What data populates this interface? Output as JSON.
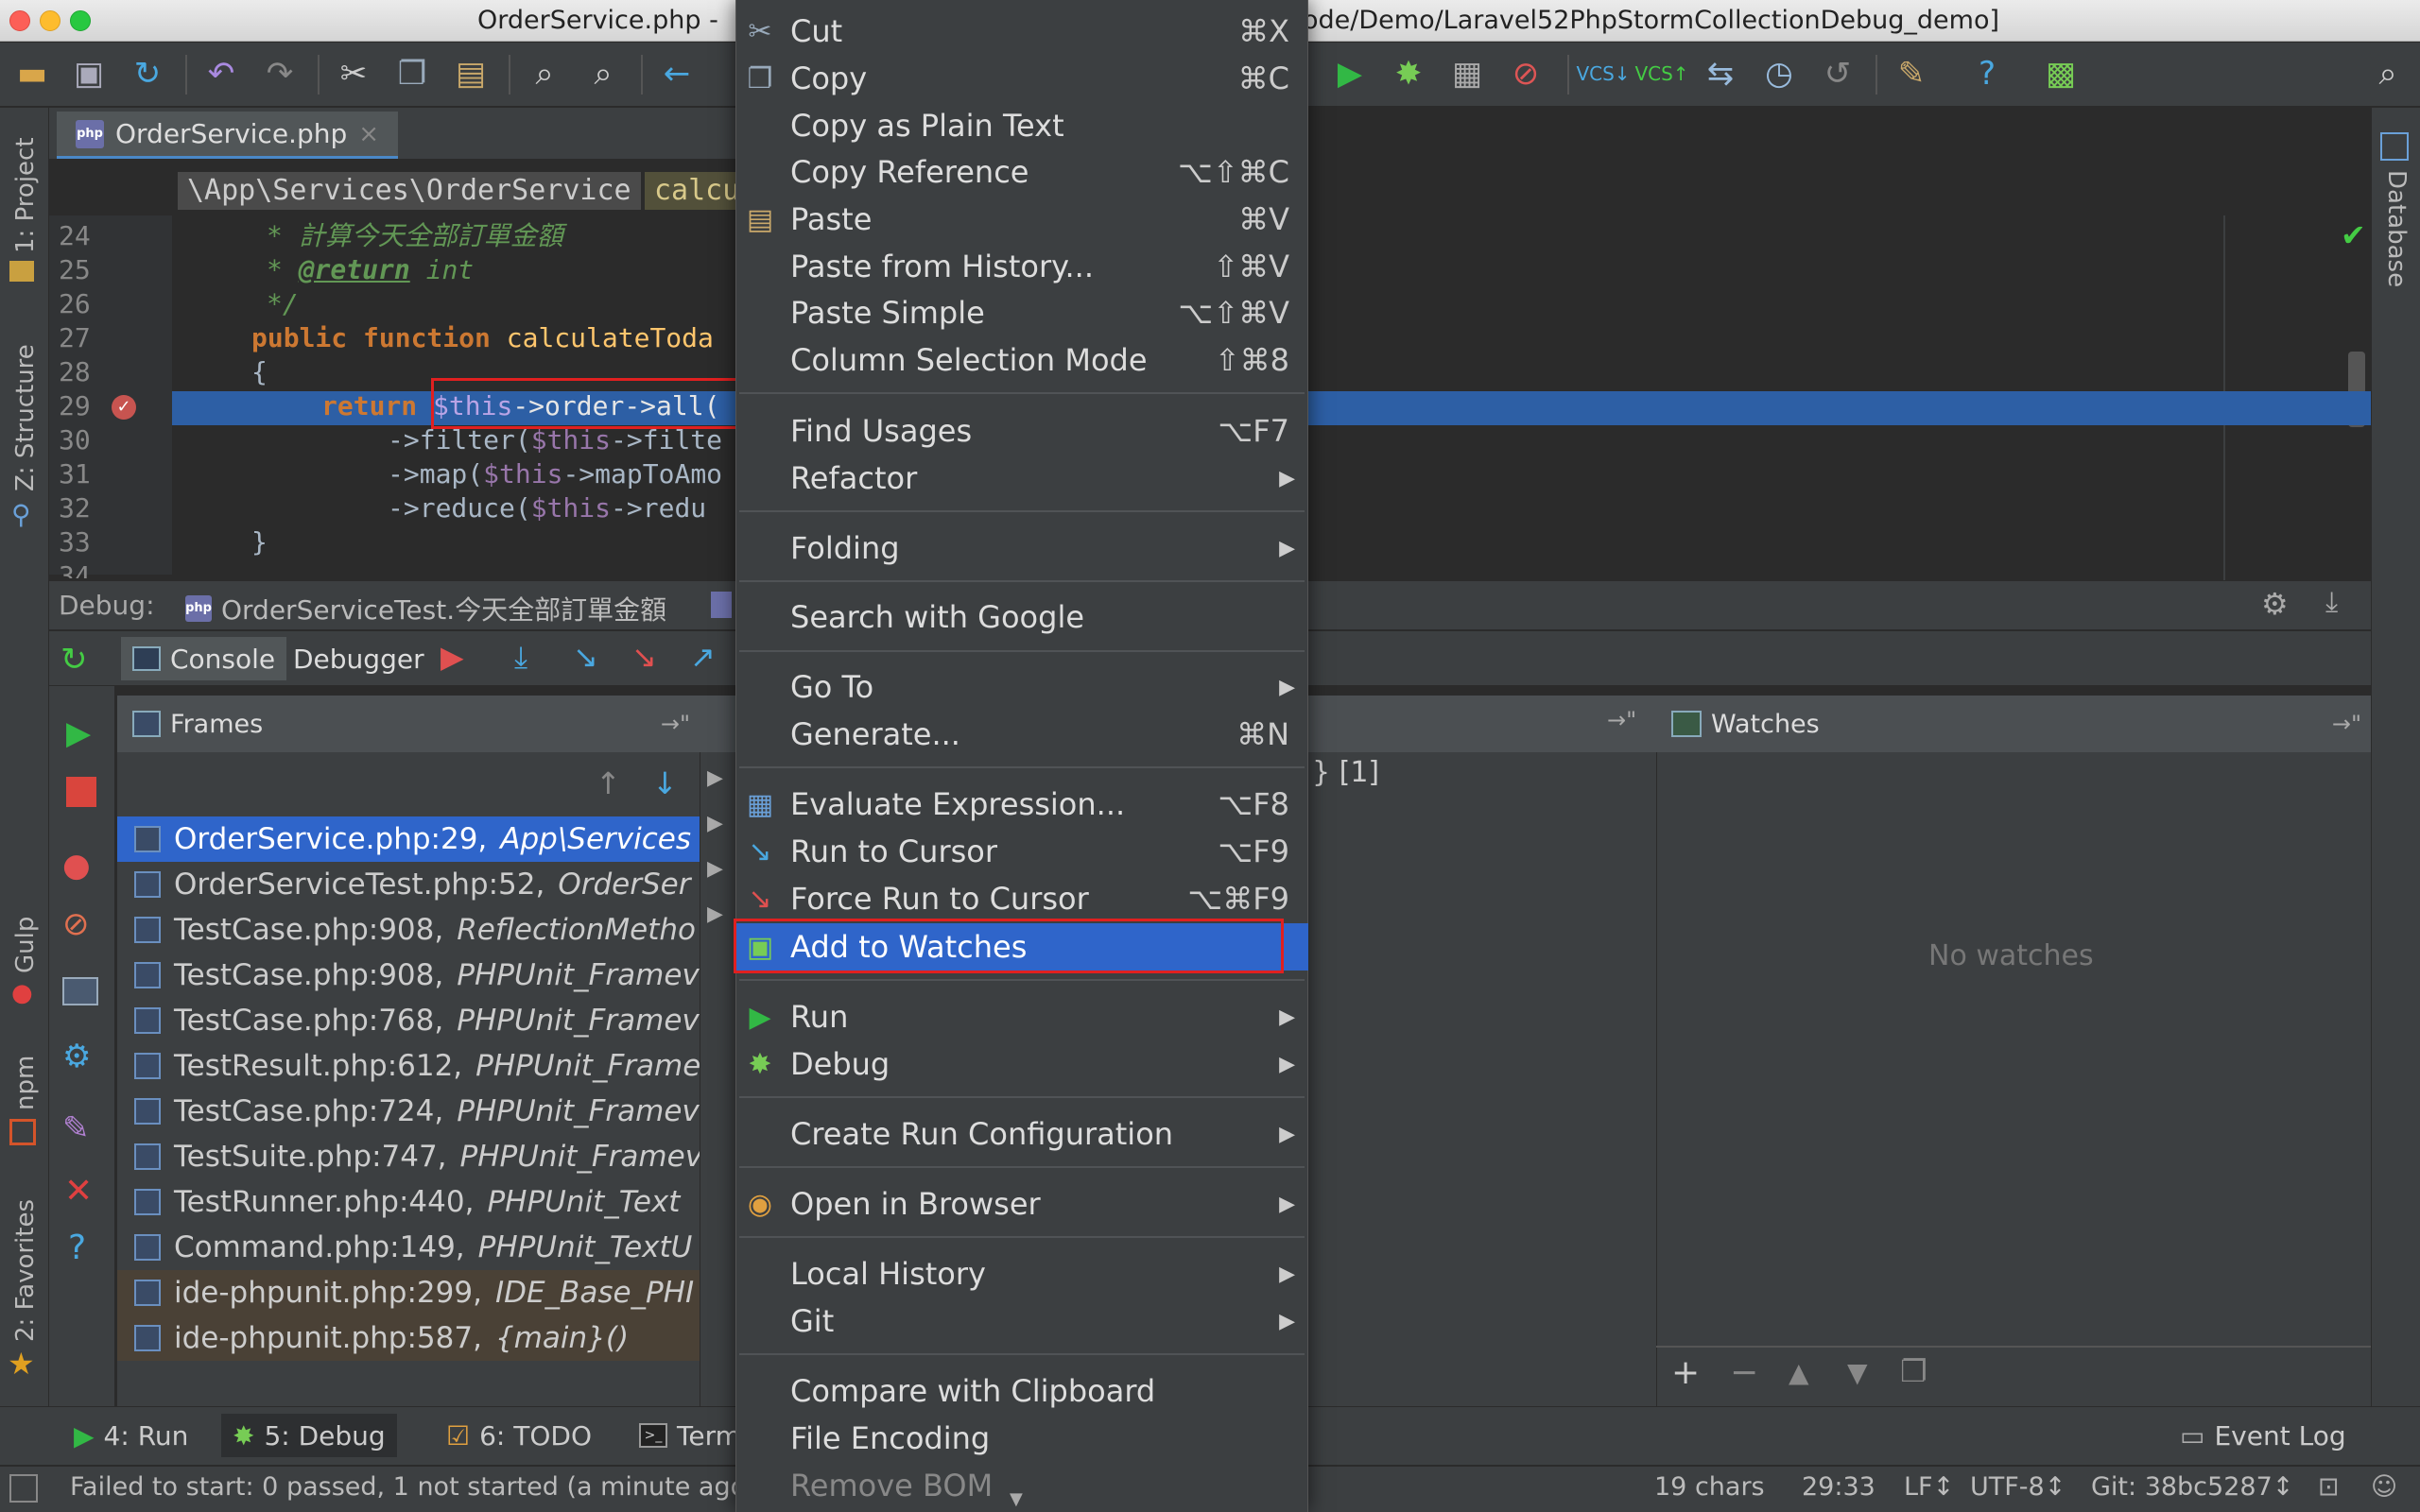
{
  "window": {
    "title_left": "OrderService.php -",
    "title_right": "ode/Demo/Laravel52PhpStormCollectionDebug_demo]"
  },
  "side_tools": {
    "project": "1: Project",
    "structure": "Z: Structure",
    "gulp": "Gulp",
    "npm": "npm",
    "favorites": "2: Favorites",
    "database": "Database"
  },
  "editor": {
    "tab_label": "OrderService.php",
    "breadcrumb_class": "\\App\\Services\\OrderService",
    "breadcrumb_method": "calcu",
    "line_numbers": [
      "24",
      "25",
      "26",
      "27",
      "28",
      "29",
      "30",
      "31",
      "32",
      "33",
      "34"
    ],
    "lines": {
      "l24_comment": "* 計算今天全部訂單金額",
      "l25_star": "* ",
      "l25_tag": "@return",
      "l25_type": " int",
      "l26": "*/",
      "l27_kw": "public function",
      "l27_fn": " calculateToda",
      "l28": "{",
      "l29_kw": "return",
      "l29_var": "$this",
      "l29_rest": "->order->all(",
      "l30_a": "->filter(",
      "l30_var": "$this",
      "l30_b": "->filte",
      "l31_a": "->map(",
      "l31_var": "$this",
      "l31_b": "->mapToAmo",
      "l32_a": "->reduce(",
      "l32_var": "$this",
      "l32_b": "->redu",
      "l33": "}"
    }
  },
  "debug": {
    "label": "Debug:",
    "session": "OrderServiceTest.今天全部訂單金額",
    "tab_console": "Console",
    "tab_debugger": "Debugger",
    "frames_title": "Frames",
    "watches_title": "Watches",
    "no_watches": "No watches",
    "variables_count": "} [1]",
    "frames": [
      {
        "file": "OrderService.php:29,",
        "ctx": "App\\Services"
      },
      {
        "file": "OrderServiceTest.php:52,",
        "ctx": "OrderSer"
      },
      {
        "file": "TestCase.php:908,",
        "ctx": "ReflectionMetho"
      },
      {
        "file": "TestCase.php:908,",
        "ctx": "PHPUnit_Framev"
      },
      {
        "file": "TestCase.php:768,",
        "ctx": "PHPUnit_Framev"
      },
      {
        "file": "TestResult.php:612,",
        "ctx": "PHPUnit_Frame"
      },
      {
        "file": "TestCase.php:724,",
        "ctx": "PHPUnit_Framev"
      },
      {
        "file": "TestSuite.php:747,",
        "ctx": "PHPUnit_Framev"
      },
      {
        "file": "TestRunner.php:440,",
        "ctx": "PHPUnit_Text"
      },
      {
        "file": "Command.php:149,",
        "ctx": "PHPUnit_TextU"
      },
      {
        "file": "ide-phpunit.php:299,",
        "ctx": "IDE_Base_PHI"
      },
      {
        "file": "ide-phpunit.php:587,",
        "ctx": "{main}()"
      }
    ]
  },
  "bottom_tabs": {
    "run": "4: Run",
    "debug": "5: Debug",
    "todo": "6: TODO",
    "terminal": "Termi",
    "event_log": "Event Log"
  },
  "status": {
    "message": "Failed to start: 0 passed, 1 not started (a minute ago",
    "chars": "19 chars",
    "position": "29:33",
    "line_sep": "LF↕",
    "encoding": "UTF-8↕",
    "git": "Git: 38bc5287↕"
  },
  "context_menu": {
    "items": [
      {
        "label": "Cut",
        "shortcut": "⌘X"
      },
      {
        "label": "Copy",
        "shortcut": "⌘C"
      },
      {
        "label": "Copy as Plain Text",
        "shortcut": ""
      },
      {
        "label": "Copy Reference",
        "shortcut": "⌥⇧⌘C"
      },
      {
        "label": "Paste",
        "shortcut": "⌘V"
      },
      {
        "label": "Paste from History...",
        "shortcut": "⇧⌘V"
      },
      {
        "label": "Paste Simple",
        "shortcut": "⌥⇧⌘V"
      },
      {
        "label": "Column Selection Mode",
        "shortcut": "⇧⌘8"
      },
      {
        "label": "Find Usages",
        "shortcut": "⌥F7"
      },
      {
        "label": "Refactor",
        "shortcut": ""
      },
      {
        "label": "Folding",
        "shortcut": ""
      },
      {
        "label": "Search with Google",
        "shortcut": ""
      },
      {
        "label": "Go To",
        "shortcut": ""
      },
      {
        "label": "Generate...",
        "shortcut": "⌘N"
      },
      {
        "label": "Evaluate Expression...",
        "shortcut": "⌥F8"
      },
      {
        "label": "Run to Cursor",
        "shortcut": "⌥F9"
      },
      {
        "label": "Force Run to Cursor",
        "shortcut": "⌥⌘F9"
      },
      {
        "label": "Add to Watches",
        "shortcut": ""
      },
      {
        "label": "Run",
        "shortcut": ""
      },
      {
        "label": "Debug",
        "shortcut": ""
      },
      {
        "label": "Create Run Configuration",
        "shortcut": ""
      },
      {
        "label": "Open in Browser",
        "shortcut": ""
      },
      {
        "label": "Local History",
        "shortcut": ""
      },
      {
        "label": "Git",
        "shortcut": ""
      },
      {
        "label": "Compare with Clipboard",
        "shortcut": ""
      },
      {
        "label": "File Encoding",
        "shortcut": ""
      },
      {
        "label": "Remove BOM",
        "shortcut": ""
      }
    ]
  },
  "colors": {
    "selection": "#2f65ca",
    "highlight_box": "#e02020",
    "breakpoint_line": "#2d5fa5"
  }
}
